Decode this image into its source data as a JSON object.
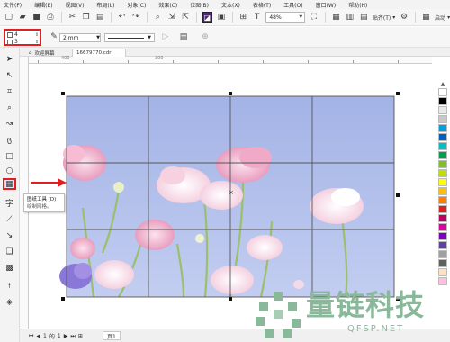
{
  "menubar": {
    "items": [
      "文件(F)",
      "编辑(E)",
      "视图(V)",
      "布局(L)",
      "对象(C)",
      "效果(C)",
      "位图(B)",
      "文本(X)",
      "表格(T)",
      "工具(O)",
      "窗口(W)",
      "帮助(H)"
    ]
  },
  "toolbar": {
    "zoom_value": "48%",
    "snap_label": "贴齐(T)",
    "launch_label": "启动"
  },
  "property_bar": {
    "grid_columns": "4",
    "grid_rows": "3",
    "outline_width": "2 mm"
  },
  "tabs": {
    "home_label": "欢迎屏幕",
    "file_label": "16679770.cdr"
  },
  "tooltip": {
    "title": "图纸工具 (D)",
    "description": "绘制网格。"
  },
  "pager": {
    "current": "1",
    "separator": "的",
    "total": "1",
    "page_label": "页1"
  },
  "watermark": {
    "text": "量链科技",
    "subtext": "QFSP.NET"
  },
  "ruler": {
    "top_labels": [
      "400",
      "300"
    ]
  },
  "colors": {
    "highlight": "#e02020",
    "sky": "#a9b9e6",
    "watermark": "#8ab89b"
  },
  "palette": [
    "#ffffff",
    "#000000",
    "#e8e8e8",
    "#c8c8c8",
    "#00a0e0",
    "#0060c0",
    "#00c0c0",
    "#00a050",
    "#80c020",
    "#c0e000",
    "#ffff00",
    "#ffc000",
    "#ff8000",
    "#e02020",
    "#c00060",
    "#e000a0",
    "#8000c0",
    "#6040a0",
    "#a0a0a0",
    "#606060",
    "#ffe0c0",
    "#ffc0e0"
  ]
}
